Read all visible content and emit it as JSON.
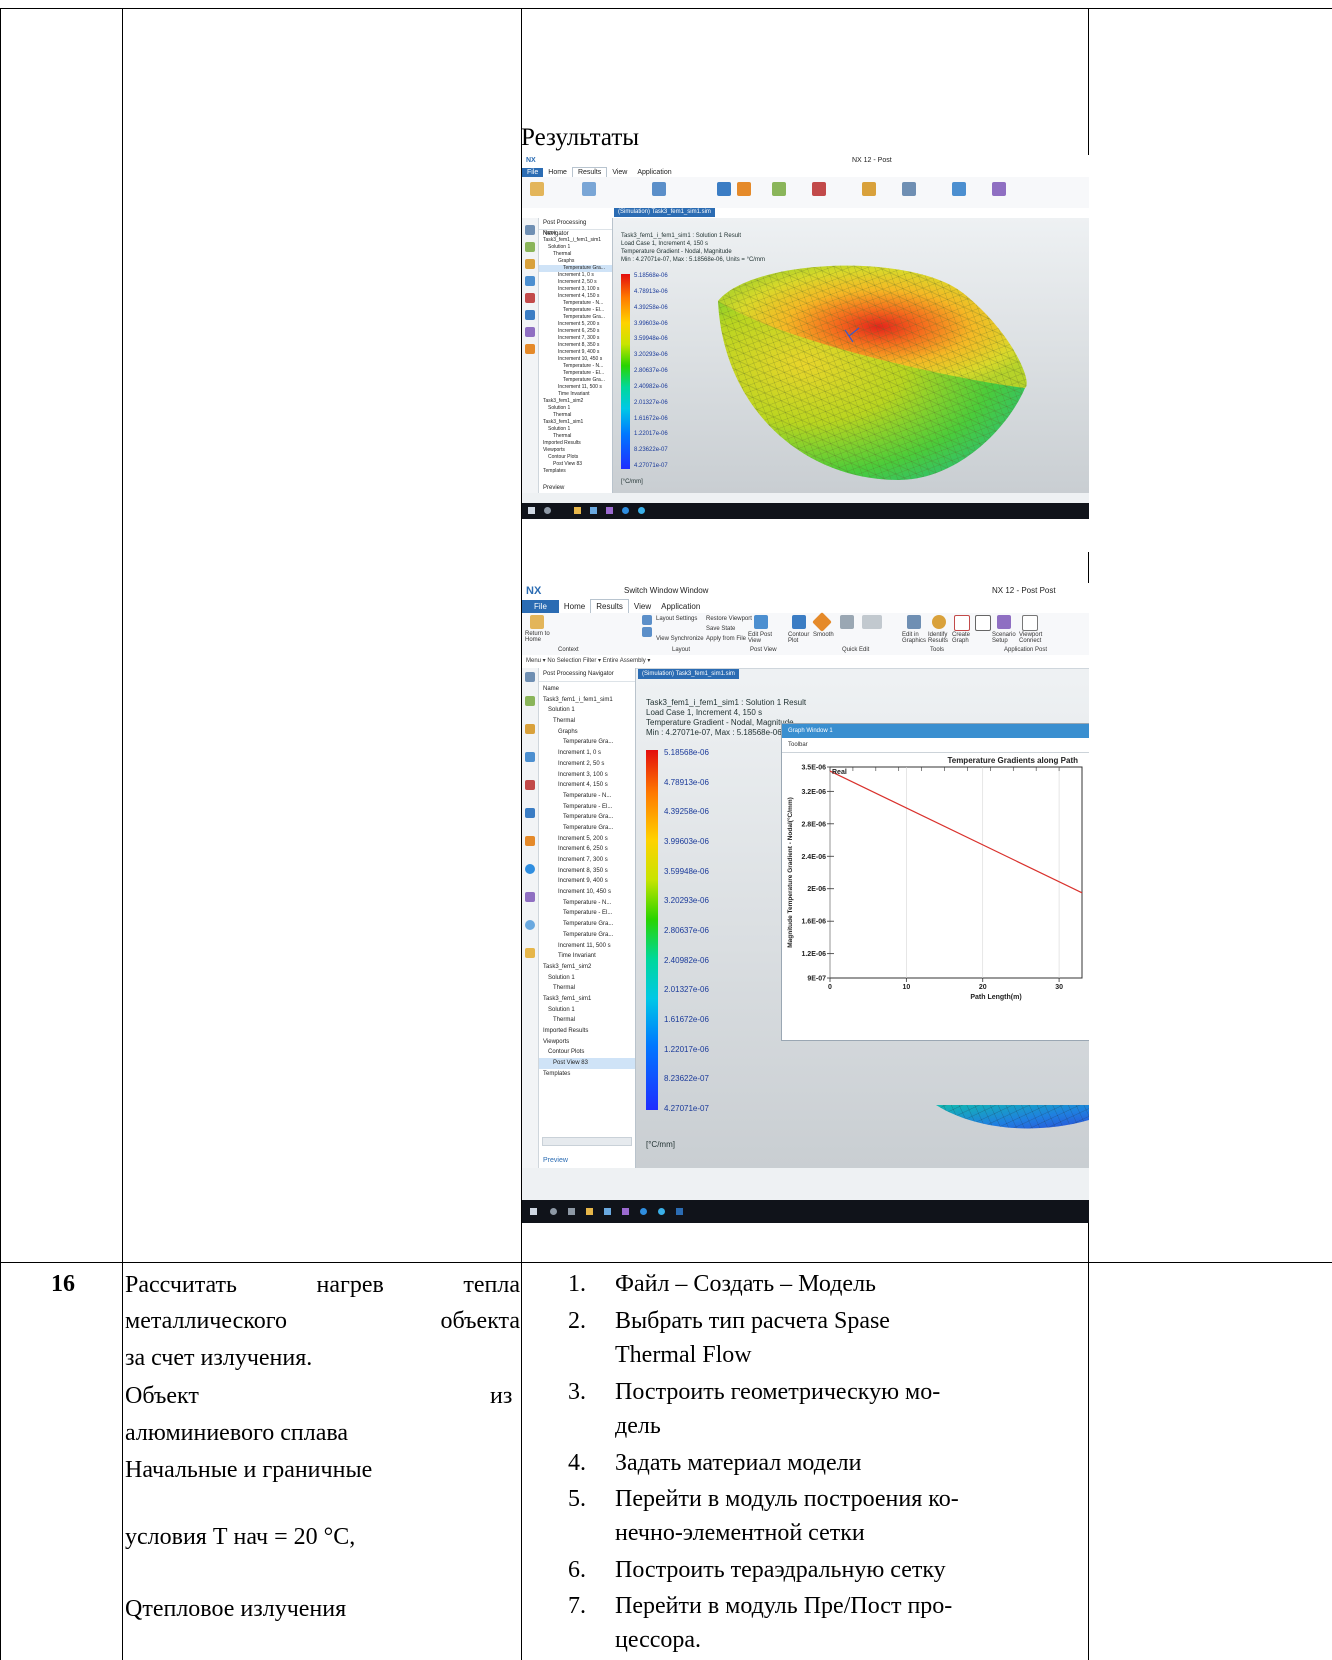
{
  "section": {
    "heading": "Результаты"
  },
  "screenshot1": {
    "title_bar": "NX 12 - Post",
    "menu": [
      "File",
      "Home",
      "Results",
      "View",
      "Application"
    ],
    "active_menu": "Results",
    "tab": "(Simulation) Task3_fem1_sim1.sim",
    "info": [
      "Task3_fem1_i_fem1_sim1 : Solution 1 Result",
      "Load Case 1, Increment 4, 150 s",
      "Temperature Gradient - Nodal, Magnitude",
      "Min : 4.27071e-07, Max : 5.18568e-06, Units = °C/mm"
    ],
    "legend": [
      "5.18568e-06",
      "4.78913e-06",
      "4.39258e-06",
      "3.99603e-06",
      "3.59948e-06",
      "3.20293e-06",
      "2.80637e-06",
      "2.40982e-06",
      "2.01327e-06",
      "1.61672e-06",
      "1.22017e-06",
      "8.23622e-07",
      "4.27071e-07"
    ],
    "units": "[°C/mm]",
    "nav_title": "Post Processing Navigator",
    "nav_rows": [
      "Name",
      "Task3_fem1_i_fem1_sim1",
      "Solution 1",
      "Thermal",
      "Graphs",
      "Temperature Gra...",
      "Increment 1, 0 s",
      "Increment 2, 50 s",
      "Increment 3, 100 s",
      "Increment 4, 150 s",
      "Temperature - N...",
      "Temperature - El...",
      "Temperature Gra...",
      "Increment 5, 200 s",
      "Increment 6, 250 s",
      "Increment 7, 300 s",
      "Increment 8, 350 s",
      "Increment 9, 400 s",
      "Increment 10, 450 s",
      "Temperature - N...",
      "Temperature - El...",
      "Temperature Gra...",
      "Increment 11, 500 s",
      "Time Invariant",
      "Task3_fem1_sim2",
      "Solution 1",
      "Thermal",
      "Task3_fem1_sim1",
      "Solution 1",
      "Thermal",
      "Imported Results",
      "Viewports",
      "Contour Plots",
      "Post View 83",
      "Templates"
    ],
    "nav_footer": "Preview"
  },
  "screenshot2": {
    "title_bar_left": "Switch Window",
    "title_bar_window": "Window",
    "title_bar_right": "NX 12 - Post Post",
    "menu": [
      "File",
      "Home",
      "Results",
      "View",
      "Application"
    ],
    "active_menu": "Results",
    "ribbon": {
      "return_home": "Return to Home",
      "layout_settings": "Layout Settings",
      "restore_viewport": "Restore Viewport",
      "save_state": "Save State",
      "view_synchronize": "View Synchronize",
      "apply_from_file": "Apply from File",
      "edit_post_view": "Edit Post View",
      "contour_plot": "Contour Plot",
      "smooth": "Smooth",
      "edit_in_graphics": "Edit in Graphics",
      "identify_results": "Identify Results",
      "create_graph": "Create Graph",
      "scenario_setup": "Scenario Setup",
      "viewport_connect": "Viewport Connect",
      "group_context": "Context",
      "group_layout": "Layout",
      "group_post_view": "Post View",
      "group_quick_edit": "Quick Edit",
      "group_tools": "Tools",
      "group_app": "Application Post"
    },
    "filter_bar": "Menu ▾   No Selection Filter ▾   Entire Assembly ▾",
    "nav_title": "Post Processing Navigator",
    "nav_rows": [
      "Name",
      "Task3_fem1_i_fem1_sim1",
      "Solution 1",
      "Thermal",
      "Graphs",
      "Temperature Gra...",
      "Increment 1, 0 s",
      "Increment 2, 50 s",
      "Increment 3, 100 s",
      "Increment 4, 150 s",
      "Temperature - N...",
      "Temperature - El...",
      "Temperature Gra...",
      "Temperature Gra...",
      "Increment 5, 200 s",
      "Increment 6, 250 s",
      "Increment 7, 300 s",
      "Increment 8, 350 s",
      "Increment 9, 400 s",
      "Increment 10, 450 s",
      "Temperature - N...",
      "Temperature - El...",
      "Temperature Gra...",
      "Temperature Gra...",
      "Increment 11, 500 s",
      "Time Invariant",
      "Task3_fem1_sim2",
      "Solution 1",
      "Thermal",
      "Task3_fem1_sim1",
      "Solution 1",
      "Thermal",
      "Imported Results",
      "Viewports",
      "Contour Plots",
      "Post View 83",
      "Templates"
    ],
    "nav_footer": "Preview",
    "tab": "(Simulation) Task3_fem1_sim1.sim",
    "info": [
      "Task3_fem1_i_fem1_sim1 : Solution 1 Result",
      "Load Case 1, Increment 4, 150 s",
      "Temperature Gradient - Nodal, Magnitude",
      "Min : 4.27071e-07, Max : 5.18568e-06, Units = °C/mm"
    ],
    "legend": [
      "5.18568e-06",
      "4.78913e-06",
      "4.39258e-06",
      "3.99603e-06",
      "3.59948e-06",
      "3.20293e-06",
      "2.80637e-06",
      "2.40982e-06",
      "2.01327e-06",
      "1.61672e-06",
      "1.22017e-06",
      "8.23622e-07",
      "4.27071e-07"
    ],
    "units": "[°C/mm]",
    "graph_window": {
      "title": "Graph Window 1",
      "toolbar": "Toolbar"
    }
  },
  "chart_data": {
    "type": "line",
    "title": "Temperature Gradients along Path",
    "xlabel": "Path Length(m)",
    "ylabel": "Magnitude Temperature Gradient - Nodal(°C/mm)",
    "xlim": [
      0,
      33
    ],
    "ylim": [
      9e-07,
      3.5e-06
    ],
    "x_ticks": [
      "0",
      "10",
      "20",
      "30"
    ],
    "y_ticks": [
      "3.5E-06",
      "3.2E-06",
      "2.8E-06",
      "2.4E-06",
      "2E-06",
      "1.6E-06",
      "1.2E-06",
      "9E-07"
    ],
    "series": [
      {
        "name": "Real",
        "color": "#d9312c",
        "x": [
          0,
          33
        ],
        "y": [
          3.45e-06,
          1.95e-06
        ]
      }
    ]
  },
  "row16": {
    "number": "16",
    "task_lines": [
      "Рассчитать нагрев тепла",
      "металлического объекта",
      "за счет излучения.",
      "Объект",
      "из",
      "алюминиевого сплава",
      "Начальные и граничные",
      "условия  Т нач = 20 °C,",
      "Qтепловое излучения"
    ],
    "steps": [
      {
        "n": "1.",
        "lines": [
          " Файл – Создать – Модель"
        ]
      },
      {
        "n": "2.",
        "lines": [
          "Выбрать тип расчета  Spase",
          "Thermal Flow"
        ]
      },
      {
        "n": "3.",
        "lines": [
          "Построить геометрическую мо-",
          "дель"
        ]
      },
      {
        "n": "4.",
        "lines": [
          "Задать материал модели"
        ]
      },
      {
        "n": "5.",
        "lines": [
          "Перейти в модуль построения ко-",
          "нечно-элементной сетки"
        ]
      },
      {
        "n": "6.",
        "lines": [
          "Построить тераэдральную сетку"
        ]
      },
      {
        "n": "7.",
        "lines": [
          "Перейти в модуль Пре/Пост про-",
          "цессора."
        ]
      }
    ]
  }
}
